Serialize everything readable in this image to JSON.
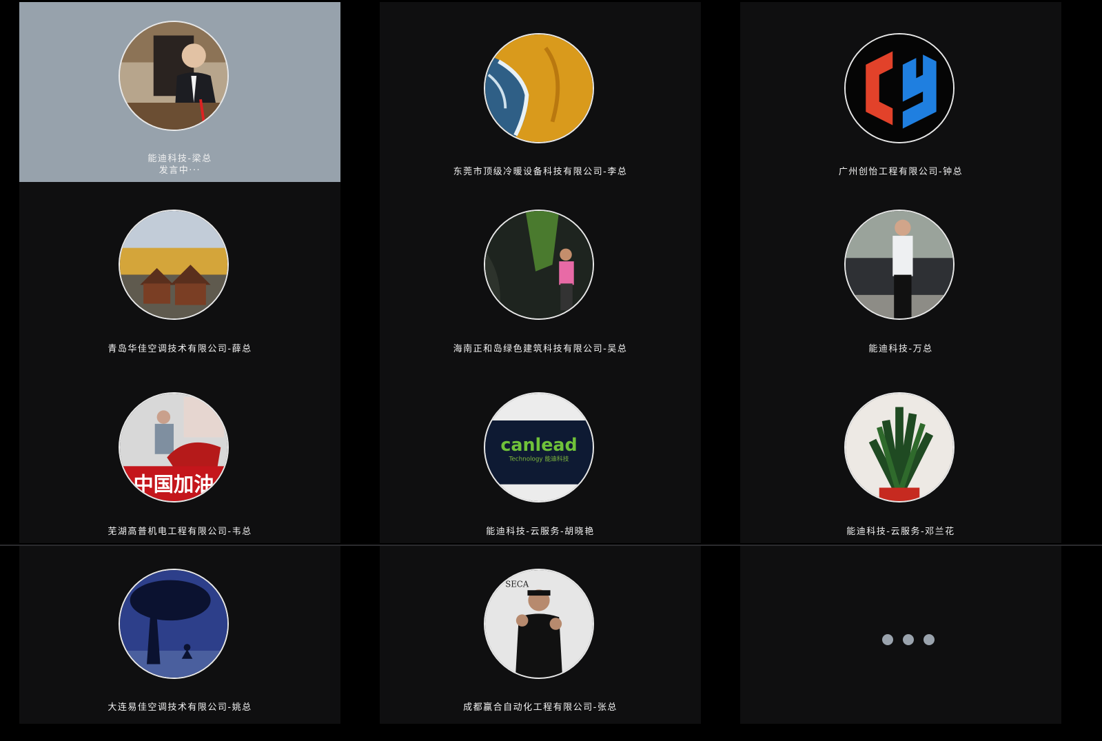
{
  "participants": [
    {
      "name": "能迪科技-梁总",
      "status": "发言中···",
      "avatar": "person-in-suit-photo"
    },
    {
      "name": "东莞市顶级冷暖设备科技有限公司-李总",
      "avatar": "beach-waves-photo"
    },
    {
      "name": "广州创怡工程有限公司-钟总",
      "avatar": "cy-logo"
    },
    {
      "name": "青岛华佳空调技术有限公司-薛总",
      "avatar": "wooden-houses-photo"
    },
    {
      "name": "海南正和岛绿色建筑科技有限公司-吴总",
      "avatar": "canyon-hiker-photo"
    },
    {
      "name": "能迪科技-万总",
      "avatar": "man-by-car-photo"
    },
    {
      "name": "芜湖高普机电工程有限公司-韦总",
      "avatar": "man-with-bull-statue-photo",
      "avatar_text": "中国加油"
    },
    {
      "name": "能迪科技-云服务-胡晓艳",
      "avatar": "canlead-logo",
      "avatar_text": "canlead",
      "avatar_subtext": "Technology 能迪科技"
    },
    {
      "name": "能迪科技-云服务-邓兰花",
      "avatar": "potted-plant-photo"
    },
    {
      "name": "大连易佳空调技术有限公司-姚总",
      "avatar": "tree-meditation-illustration"
    },
    {
      "name": "成都赢合自动化工程有限公司-张总",
      "avatar": "athlete-photo",
      "avatar_text": "SECA"
    }
  ],
  "more_tile": {
    "icon": "more-dots-icon"
  },
  "colors": {
    "tile_bg": "#0f0f10",
    "active_tile_bg": "#97a2ac",
    "text": "#f2f2f2",
    "dots": "#9aa3ad"
  }
}
